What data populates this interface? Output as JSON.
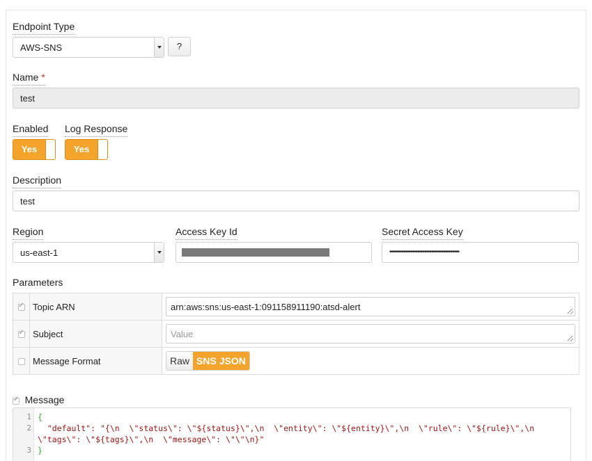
{
  "form": {
    "endpoint_type": {
      "label": "Endpoint Type",
      "value": "AWS-SNS",
      "help_label": "?"
    },
    "name": {
      "label": "Name",
      "required_mark": "*",
      "value": "test"
    },
    "enabled": {
      "label": "Enabled",
      "value": "Yes"
    },
    "log_response": {
      "label": "Log Response",
      "value": "Yes"
    },
    "description": {
      "label": "Description",
      "value": "test"
    },
    "region": {
      "label": "Region",
      "value": "us-east-1"
    },
    "access_key_id": {
      "label": "Access Key Id"
    },
    "secret_access_key": {
      "label": "Secret Access Key",
      "value": "••••••••••••••••••••••••••••••••••••••••"
    },
    "parameters": {
      "label": "Parameters",
      "rows": [
        {
          "name": "Topic ARN",
          "checked": true,
          "value": "arn:aws:sns:us-east-1:091158911190:atsd-alert"
        },
        {
          "name": "Subject",
          "checked": true,
          "placeholder": "Value"
        },
        {
          "name": "Message Format",
          "checked": false,
          "options": [
            "Raw",
            "SNS JSON"
          ],
          "selected": "SNS JSON"
        }
      ]
    },
    "message": {
      "label": "Message",
      "checked": true,
      "line_numbers": [
        "1",
        "2",
        "",
        "3"
      ],
      "lines": [
        "{",
        "  \"default\": \"{\\n  \\\"status\\\": \\\"${status}\\\",\\n  \\\"entity\\\": \\\"${entity}\\\",\\n  \\\"rule\\\": \\\"${rule}\\\",\\n",
        "\\\"tags\\\": \\\"${tags}\\\",\\n  \\\"message\\\": \\\"\\\"\\n}\"",
        "}"
      ]
    }
  },
  "colors": {
    "accent": "#f5a42b",
    "required": "#d9302b",
    "code_string": "#a31515",
    "code_brace": "#2bb52b"
  }
}
